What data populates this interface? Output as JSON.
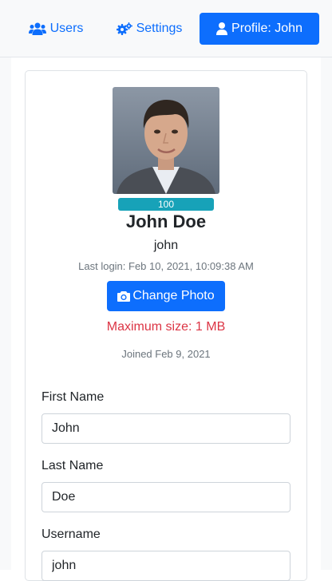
{
  "nav": {
    "users_label": "Users",
    "settings_label": "Settings",
    "profile_label": "Profile: John"
  },
  "profile": {
    "score": "100",
    "full_name": "John Doe",
    "username": "john",
    "last_login": "Last login: Feb 10, 2021, 10:09:38 AM",
    "change_photo_label": "Change Photo",
    "max_size_note": "Maximum size: 1 MB",
    "joined": "Joined Feb 9, 2021"
  },
  "form": {
    "first_name_label": "First Name",
    "first_name_value": "John",
    "last_name_label": "Last Name",
    "last_name_value": "Doe",
    "username_label": "Username",
    "username_value": "john"
  },
  "colors": {
    "primary": "#0d6efd",
    "badge": "#17a2b8",
    "danger": "#dc3545"
  },
  "icons": {
    "users": "users-icon",
    "settings": "cogs-icon",
    "profile": "user-icon",
    "camera": "camera-icon"
  }
}
